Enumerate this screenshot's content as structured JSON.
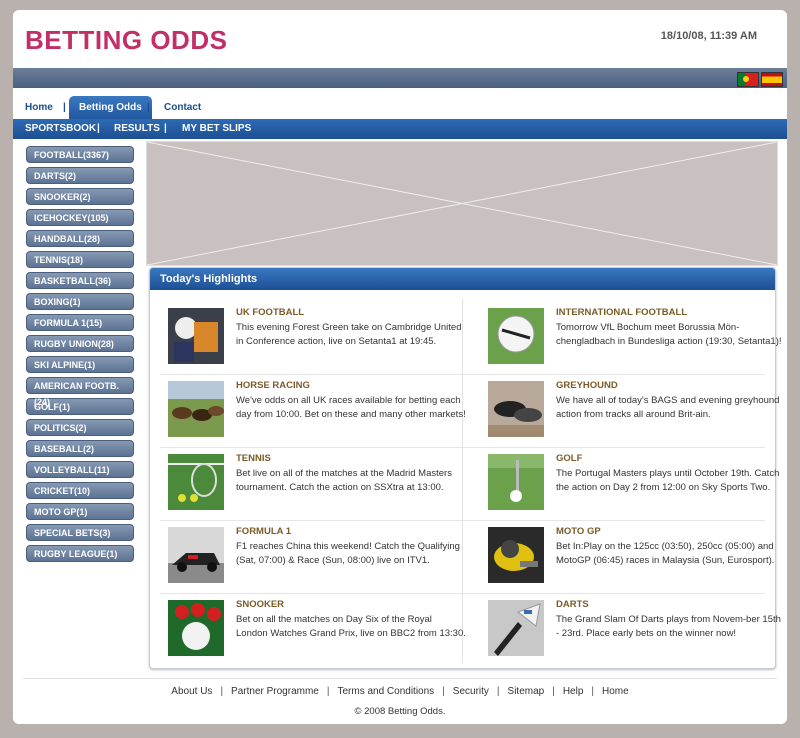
{
  "header": {
    "logo": "BETTING ODDS",
    "datetime": "18/10/08, 11:39 AM",
    "flags": [
      "portugal-flag",
      "spain-flag"
    ]
  },
  "tabs": [
    "Home",
    "Betting Odds",
    "Contact"
  ],
  "subnav": [
    "SPORTSBOOK",
    "RESULTS",
    "MY BET SLIPS"
  ],
  "sidebar": {
    "sports": [
      "FOOTBALL(3367)",
      "DARTS(2)",
      "SNOOKER(2)",
      "ICEHOCKEY(105)",
      "HANDBALL(28)",
      "TENNIS(18)",
      "BASKETBALL(36)",
      "BOXING(1)",
      "FORMULA 1(15)",
      "RUGBY UNION(28)",
      "SKI ALPINE(1)",
      "AMERICAN FOOTB.(24)",
      "GOLF(1)",
      "POLITICS(2)",
      "BASEBALL(2)",
      "VOLLEYBALL(11)",
      "CRICKET(10)",
      "MOTO GP(1)",
      "SPECIAL BETS(3)",
      "RUGBY LEAGUE(1)"
    ]
  },
  "highlights": {
    "title": "Today's Highlights",
    "items": [
      {
        "title": "UK FOOTBALL",
        "text": "This evening Forest Green take on Cambridge United in Conference action, live on Setanta1 at 19:45."
      },
      {
        "title": "INTERNATIONAL FOOTBALL",
        "text": "Tomorrow VfL Bochum meet Borussia Mön-chengladbach in Bundesliga action (19:30, Setanta1)!"
      },
      {
        "title": "HORSE RACING",
        "text": "We've odds on all UK races available for betting each day from 10:00. Bet on these and many other markets!"
      },
      {
        "title": "GREYHOUND",
        "text": "We have all of today's BAGS and evening greyhound action from tracks all around Brit-ain."
      },
      {
        "title": "TENNIS",
        "text": "Bet live on all of the matches at the Madrid Masters tournament. Catch the action on SSXtra at 13:00."
      },
      {
        "title": "GOLF",
        "text": "The Portugal Masters plays until October 19th. Catch the action on Day 2 from 12:00 on Sky Sports Two."
      },
      {
        "title": "FORMULA 1",
        "text": "F1 reaches China this weekend! Catch the Qualifying (Sat, 07:00) & Race (Sun, 08:00) live on ITV1."
      },
      {
        "title": "MOTO GP",
        "text": "Bet In:Play on the 125cc (03:50), 250cc (05:00) and MotoGP (06:45) races in Malaysia (Sun, Eurosport)."
      },
      {
        "title": "SNOOKER",
        "text": "Bet on all the matches on Day Six of the Royal London Watches Grand Prix, live on BBC2 from 13:30."
      },
      {
        "title": "DARTS",
        "text": "The Grand Slam Of Darts plays from Novem-ber 15th - 23rd. Place early bets on the winner now!"
      }
    ]
  },
  "footer": {
    "links": [
      "About Us",
      "Partner Programme",
      "Terms and Conditions",
      "Security",
      "Sitemap",
      "Help",
      "Home"
    ],
    "copyright": "© 2008 Betting Odds."
  }
}
